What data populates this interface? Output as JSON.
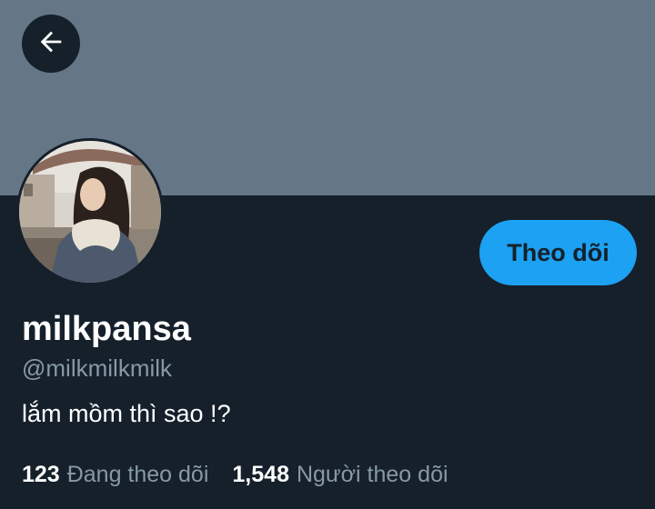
{
  "header": {
    "back_icon": "arrow-left-icon"
  },
  "profile": {
    "avatar_icon": "profile-photo",
    "display_name": "milkpansa",
    "handle": "@milkmilkmilk",
    "bio": "lắm mồm thì sao !?",
    "follow_label": "Theo dõi"
  },
  "stats": {
    "following_count": "123",
    "following_label": "Đang theo dõi",
    "followers_count": "1,548",
    "followers_label": "Người theo dõi"
  },
  "colors": {
    "background": "#15202b",
    "banner": "#657786",
    "accent": "#1da1f2",
    "secondary_text": "#8899a6",
    "primary_text": "#ffffff"
  }
}
